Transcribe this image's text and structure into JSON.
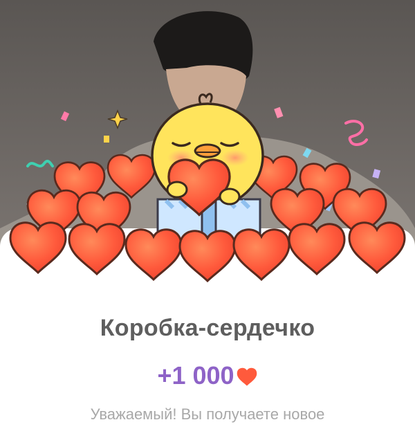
{
  "gift": {
    "title": "Коробка-сердечко",
    "reward_amount": "+1 000",
    "reward_icon": "heart-icon",
    "subtitle": "Уважаемый! Вы получаете новое"
  },
  "colors": {
    "title_text": "#5e5e5e",
    "reward_text": "#8e63c7",
    "heart_fill": "#ff5a3c",
    "chick_body": "#ffe45c",
    "sheet_bg": "#ffffff"
  },
  "illustration": {
    "character": "chick-holding-heart",
    "elements": [
      "heart-pile",
      "confetti",
      "sparkles",
      "gift-box"
    ]
  }
}
